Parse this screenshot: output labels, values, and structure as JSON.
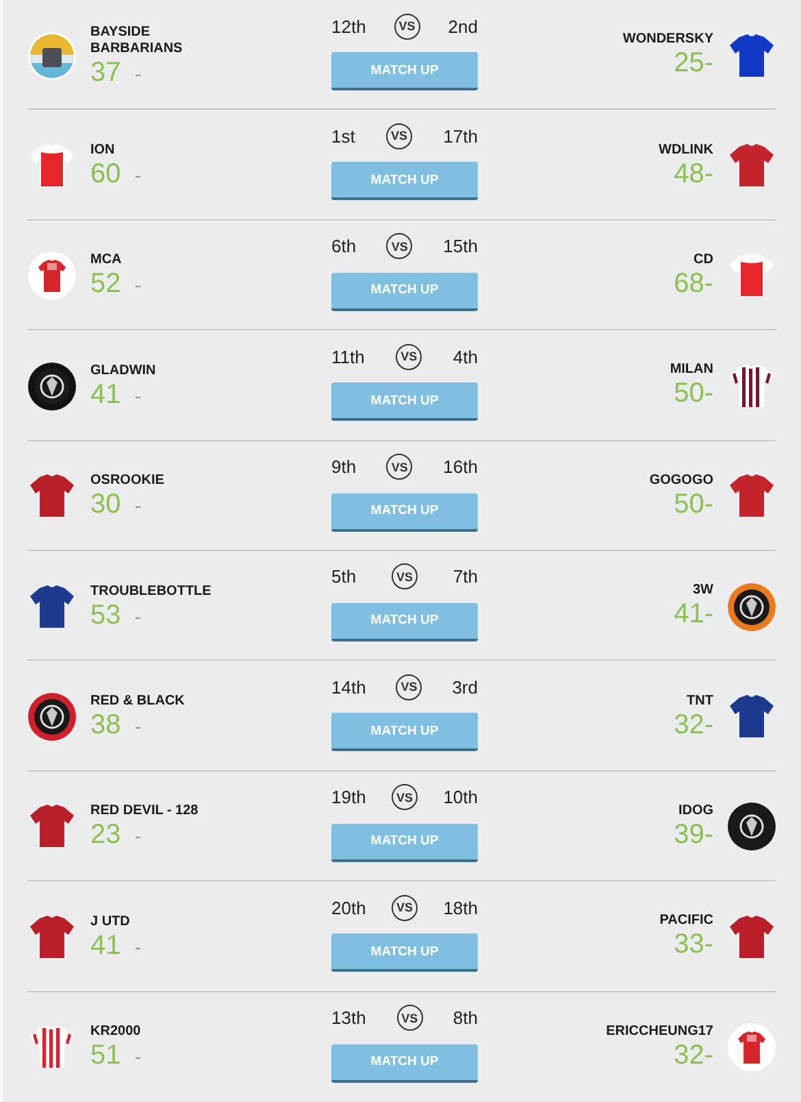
{
  "matches": [
    {
      "home": {
        "name": "BAYSIDE BARBARIANS",
        "score": "37",
        "suffix": "-",
        "rank": "12th",
        "badge": {
          "kind": "number",
          "color": "#e9b732"
        }
      },
      "vs": "VS",
      "button": "MATCH UP",
      "away": {
        "name": "WONDERSKY",
        "score": "25",
        "suffix": "-",
        "rank": "2nd",
        "badge": {
          "kind": "shirt",
          "color": "#1239c4"
        }
      }
    },
    {
      "home": {
        "name": "ION",
        "score": "60",
        "suffix": "-",
        "rank": "1st",
        "badge": {
          "kind": "raglan",
          "color": "#e5262d"
        }
      },
      "vs": "VS",
      "button": "MATCH UP",
      "away": {
        "name": "WDLINK",
        "score": "48",
        "suffix": "-",
        "rank": "17th",
        "badge": {
          "kind": "shirt",
          "color": "#c4242c"
        }
      }
    },
    {
      "home": {
        "name": "MCA",
        "score": "52",
        "suffix": "-",
        "rank": "6th",
        "badge": {
          "kind": "disc-shirt",
          "color": "#d7262b"
        }
      },
      "vs": "VS",
      "button": "MATCH UP",
      "away": {
        "name": "CD",
        "score": "68",
        "suffix": "-",
        "rank": "15th",
        "badge": {
          "kind": "raglan",
          "color": "#e5262d"
        }
      }
    },
    {
      "home": {
        "name": "GLADWIN",
        "score": "41",
        "suffix": "-",
        "rank": "11th",
        "badge": {
          "kind": "crest",
          "color": "#111111"
        }
      },
      "vs": "VS",
      "button": "MATCH UP",
      "away": {
        "name": "MILAN",
        "score": "50",
        "suffix": "-",
        "rank": "4th",
        "badge": {
          "kind": "stripes",
          "color": "#6e1a2c"
        }
      }
    },
    {
      "home": {
        "name": "OSROOKIE",
        "score": "30",
        "suffix": "-",
        "rank": "9th",
        "badge": {
          "kind": "shirt",
          "color": "#b81f28"
        }
      },
      "vs": "VS",
      "button": "MATCH UP",
      "away": {
        "name": "GOGOGO",
        "score": "50",
        "suffix": "-",
        "rank": "16th",
        "badge": {
          "kind": "shirt",
          "color": "#c4242c"
        }
      }
    },
    {
      "home": {
        "name": "TROUBLEBOTTLE",
        "score": "53",
        "suffix": "-",
        "rank": "5th",
        "badge": {
          "kind": "shirt",
          "color": "#1d3a8f"
        }
      },
      "vs": "VS",
      "button": "MATCH UP",
      "away": {
        "name": "3W",
        "score": "41",
        "suffix": "-",
        "rank": "7th",
        "badge": {
          "kind": "crest",
          "color": "#ea7a1c"
        }
      }
    },
    {
      "home": {
        "name": "RED & BLACK",
        "score": "38",
        "suffix": "-",
        "rank": "14th",
        "badge": {
          "kind": "crest",
          "color": "#d0202a"
        }
      },
      "vs": "VS",
      "button": "MATCH UP",
      "away": {
        "name": "TNT",
        "score": "32",
        "suffix": "-",
        "rank": "3rd",
        "badge": {
          "kind": "shirt",
          "color": "#1d3a8f"
        }
      }
    },
    {
      "home": {
        "name": "RED DEVIL - 128",
        "score": "23",
        "suffix": "-",
        "rank": "19th",
        "badge": {
          "kind": "shirt",
          "color": "#b81f28"
        }
      },
      "vs": "VS",
      "button": "MATCH UP",
      "away": {
        "name": "IDOG",
        "score": "39",
        "suffix": "-",
        "rank": "10th",
        "badge": {
          "kind": "crest",
          "color": "#1a1a1a"
        }
      }
    },
    {
      "home": {
        "name": "J UTD",
        "score": "41",
        "suffix": "-",
        "rank": "20th",
        "badge": {
          "kind": "shirt",
          "color": "#b81f28"
        }
      },
      "vs": "VS",
      "button": "MATCH UP",
      "away": {
        "name": "PACIFIC",
        "score": "33",
        "suffix": "-",
        "rank": "18th",
        "badge": {
          "kind": "shirt",
          "color": "#b81f28"
        }
      }
    },
    {
      "home": {
        "name": "KR2000",
        "score": "51",
        "suffix": "-",
        "rank": "13th",
        "badge": {
          "kind": "stripes",
          "color": "#d9232e"
        }
      },
      "vs": "VS",
      "button": "MATCH UP",
      "away": {
        "name": "ERICCHEUNG17",
        "score": "32",
        "suffix": "-",
        "rank": "8th",
        "badge": {
          "kind": "disc-shirt",
          "color": "#d7262b"
        }
      }
    }
  ]
}
